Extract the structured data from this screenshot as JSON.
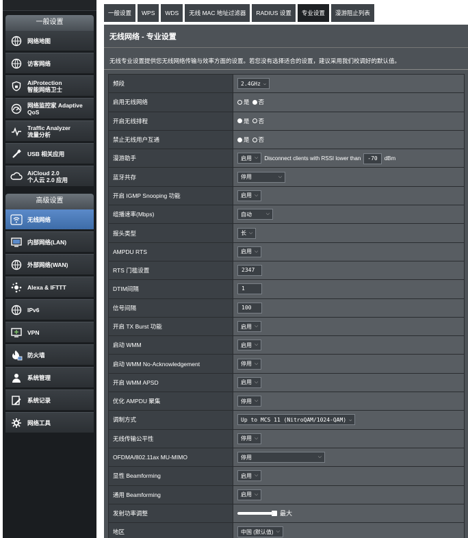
{
  "sidebar": {
    "general_header": "一般设置",
    "general_items": [
      {
        "label": "网络地图",
        "sub": "",
        "icon": "globe-map-icon"
      },
      {
        "label": "访客网络",
        "sub": "",
        "icon": "guest-network-icon"
      },
      {
        "label": "AiProtection",
        "sub": "智能网络卫士",
        "icon": "shield-lock-icon"
      },
      {
        "label": "网络监控家 Adaptive",
        "sub": "QoS",
        "icon": "speedometer-icon"
      },
      {
        "label": "Traffic Analyzer",
        "sub": "流量分析",
        "icon": "traffic-pulse-icon"
      },
      {
        "label": "USB 相关应用",
        "sub": "",
        "icon": "usb-icon"
      },
      {
        "label": "AiCloud 2.0",
        "sub": "个人云 2.0 应用",
        "icon": "cloud-icon"
      }
    ],
    "advanced_header": "高级设置",
    "advanced_items": [
      {
        "label": "无线网络",
        "icon": "wifi-icon",
        "active": true
      },
      {
        "label": "内部网络(LAN)",
        "icon": "monitor-icon",
        "active": false
      },
      {
        "label": "外部网络(WAN)",
        "icon": "globe-icon",
        "active": false
      },
      {
        "label": "Alexa & IFTTT",
        "icon": "alexa-dots-icon",
        "active": false
      },
      {
        "label": "IPv6",
        "icon": "ipv6-globe-icon",
        "active": false
      },
      {
        "label": "VPN",
        "icon": "vpn-monitor-icon",
        "active": false
      },
      {
        "label": "防火墙",
        "icon": "firewall-flame-icon",
        "active": false
      },
      {
        "label": "系统管理",
        "icon": "gear-user-icon",
        "active": false
      },
      {
        "label": "系统记录",
        "icon": "log-edit-icon",
        "active": false
      },
      {
        "label": "网络工具",
        "icon": "tools-gear-icon",
        "active": false
      }
    ]
  },
  "tabs": [
    {
      "label": "一般设置",
      "active": false
    },
    {
      "label": "WPS",
      "active": false
    },
    {
      "label": "WDS",
      "active": false
    },
    {
      "label": "无线 MAC 地址过滤器",
      "active": false
    },
    {
      "label": "RADIUS 设置",
      "active": false
    },
    {
      "label": "专业设置",
      "active": true
    },
    {
      "label": "漫游阻止列表",
      "active": false
    }
  ],
  "main": {
    "title": "无线网络 - 专业设置",
    "description": "无线专业设置提供您无线网络传输与效率方面的设置。若您没有选择适合的设置，建议采用我们校调好的默认值。",
    "rows": [
      {
        "label": "频段",
        "type": "select",
        "value": "2.4GHz",
        "mono": true
      },
      {
        "label": "启用无线网络",
        "type": "radio",
        "options": [
          "是",
          "否"
        ],
        "selected": 1
      },
      {
        "label": "开启无线排程",
        "type": "radio",
        "options": [
          "是",
          "否"
        ],
        "selected": 0
      },
      {
        "label": "禁止无线用户互通",
        "type": "radio",
        "options": [
          "是",
          "否"
        ],
        "selected": 0
      },
      {
        "label": "漫游助手",
        "type": "roaming",
        "value": "启用",
        "text1": "Disconnect clients with RSSI lower than",
        "rssi": "-70",
        "unit": "dBm"
      },
      {
        "label": "蓝牙共存",
        "type": "select",
        "value": "停用",
        "wide": 70
      },
      {
        "label": "开启 IGMP Snooping 功能",
        "type": "select",
        "value": "启用"
      },
      {
        "label": "组播速率(Mbps)",
        "type": "select",
        "value": "自动",
        "wide": 52
      },
      {
        "label": "报头类型",
        "type": "select",
        "value": "长"
      },
      {
        "label": "AMPDU RTS",
        "type": "select",
        "value": "启用"
      },
      {
        "label": "RTS 门槛设置",
        "type": "input",
        "value": "2347"
      },
      {
        "label": "DTIM间隔",
        "type": "input",
        "value": "1"
      },
      {
        "label": "信号间隔",
        "type": "input",
        "value": "100"
      },
      {
        "label": "开启 TX Burst 功能",
        "type": "select",
        "value": "启用"
      },
      {
        "label": "启动 WMM",
        "type": "select",
        "value": "启用"
      },
      {
        "label": "启动 WMM No-Acknowledgement",
        "type": "select",
        "value": "停用"
      },
      {
        "label": "开启 WMM APSD",
        "type": "select",
        "value": "启用"
      },
      {
        "label": "优化 AMPDU 聚集",
        "type": "select",
        "value": "停用"
      },
      {
        "label": "调制方式",
        "type": "select",
        "value": "Up to MCS 11 (NitroQAM/1024-QAM)",
        "mono": true
      },
      {
        "label": "无线传输公平性",
        "type": "select",
        "value": "停用"
      },
      {
        "label": "OFDMA/802.11ax MU-MIMO",
        "type": "select",
        "value": "停用",
        "wide": 128
      },
      {
        "label": "显性 Beamforming",
        "type": "select",
        "value": "启用"
      },
      {
        "label": "通用 Beamforming",
        "type": "select",
        "value": "启用"
      },
      {
        "label": "发射功率调整",
        "type": "slider",
        "value_label": "最大",
        "level": 1.0
      },
      {
        "label": "地区",
        "type": "select",
        "value": "中国 (默认值)"
      }
    ]
  }
}
